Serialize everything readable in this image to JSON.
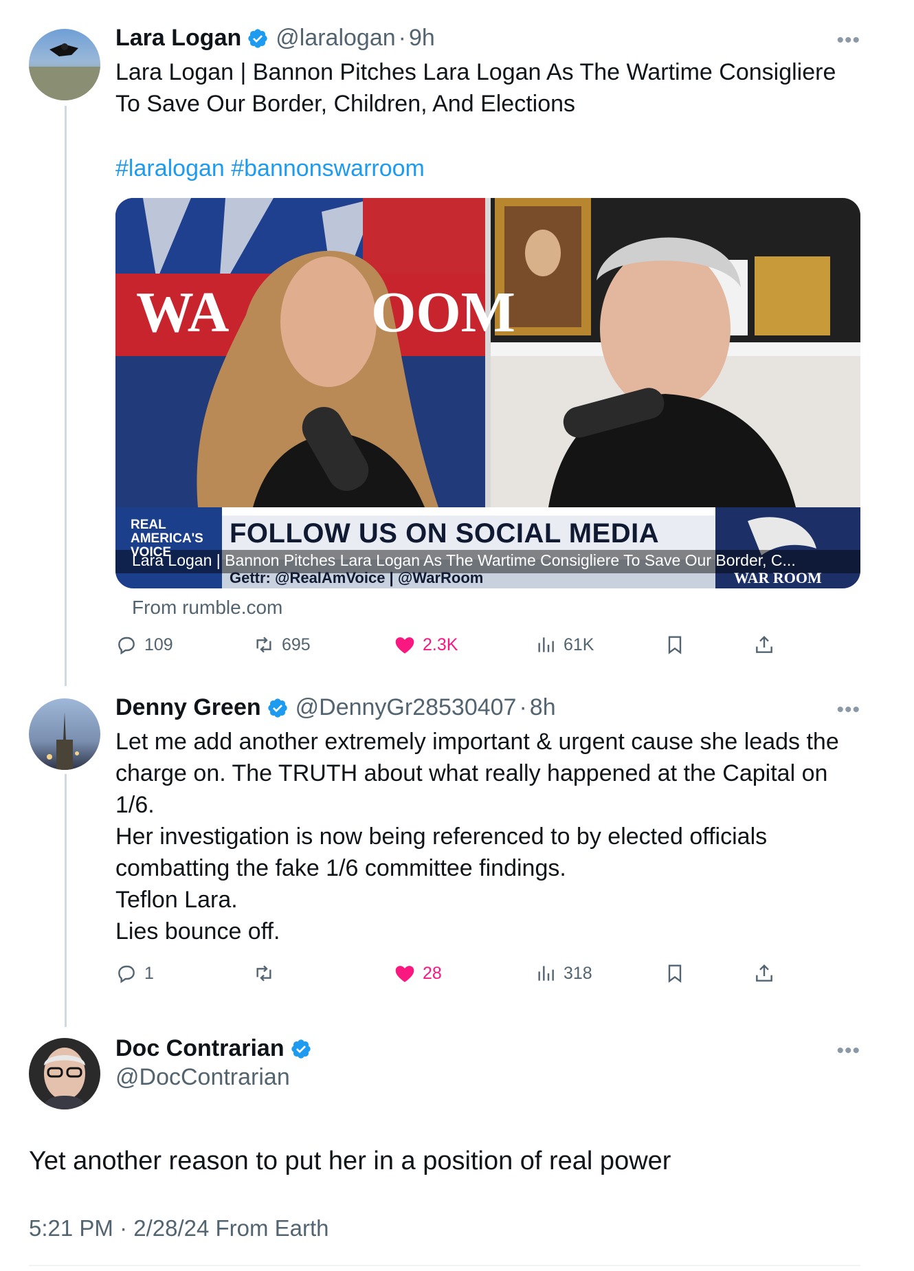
{
  "tweets": [
    {
      "name": "Lara Logan",
      "handle": "@laralogan",
      "time": "9h",
      "text": "Lara Logan | Bannon Pitches Lara Logan As The Wartime Consigliere To Save Our Border, Children, And Elections",
      "hashtags": "#laralogan #bannonswarroom",
      "card": {
        "caption": "Lara Logan | Bannon Pitches Lara Logan As The Wartime Consigliere To Save Our Border, C...",
        "source": "From rumble.com",
        "banner_text": "FOLLOW US ON SOCIAL MEDIA",
        "banner_sub": "Gettr: @RealAmVoice | @WarRoom",
        "logo_text": "REAL AMERICA'S VOICE",
        "warroom_left": "WA",
        "warroom_right": "OOM",
        "warroom_logo": "WAR ROOM"
      },
      "stats": {
        "replies": "109",
        "reposts": "695",
        "likes": "2.3K",
        "views": "61K"
      }
    },
    {
      "name": "Denny Green",
      "handle": "@DennyGr28530407",
      "time": "8h",
      "lines": [
        "Let me add another extremely important & urgent cause she leads the charge on. The TRUTH about what really happened at the Capital on 1/6.",
        "Her investigation  is now being referenced to by elected officials combatting the fake 1/6 committee findings.",
        "Teflon Lara.",
        "Lies bounce off."
      ],
      "stats": {
        "replies": "1",
        "reposts": "",
        "likes": "28",
        "views": "318"
      }
    },
    {
      "name": "Doc Contrarian",
      "handle": "@DocContrarian",
      "text": "Yet another reason to put her in a position of real power",
      "timestamp": "5:21 PM · 2/28/24 From Earth"
    }
  ],
  "ui": {
    "dot": "·",
    "more": "•••"
  },
  "colors": {
    "accent": "#1d9bf0",
    "like": "#f91880",
    "muted": "#536471"
  }
}
